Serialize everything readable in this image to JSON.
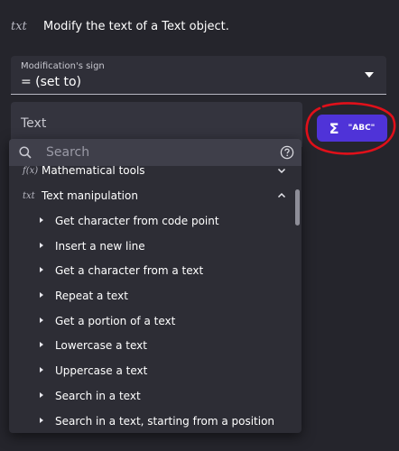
{
  "header": {
    "icon": "txt",
    "title": "Modify the text of a Text object."
  },
  "modification": {
    "label": "Modification's sign",
    "value": "= (set to)"
  },
  "text_field": {
    "label": "Text"
  },
  "expression_button": {
    "sigma": "Σ",
    "label": "\"ABC\""
  },
  "search": {
    "placeholder": "Search"
  },
  "categories": [
    {
      "icon": "f(x)",
      "label": "Mathematical tools",
      "expanded": false
    },
    {
      "icon": "txt",
      "label": "Text manipulation",
      "expanded": true
    }
  ],
  "items": [
    "Get character from code point",
    "Insert a new line",
    "Get a character from a text",
    "Repeat a text",
    "Get a portion of a text",
    "Lowercase a text",
    "Uppercase a text",
    "Search in a text",
    "Search in a text, starting from a position"
  ],
  "colors": {
    "background": "#25252c",
    "accent": "#4f33d8",
    "annotation": "#e0101a"
  }
}
